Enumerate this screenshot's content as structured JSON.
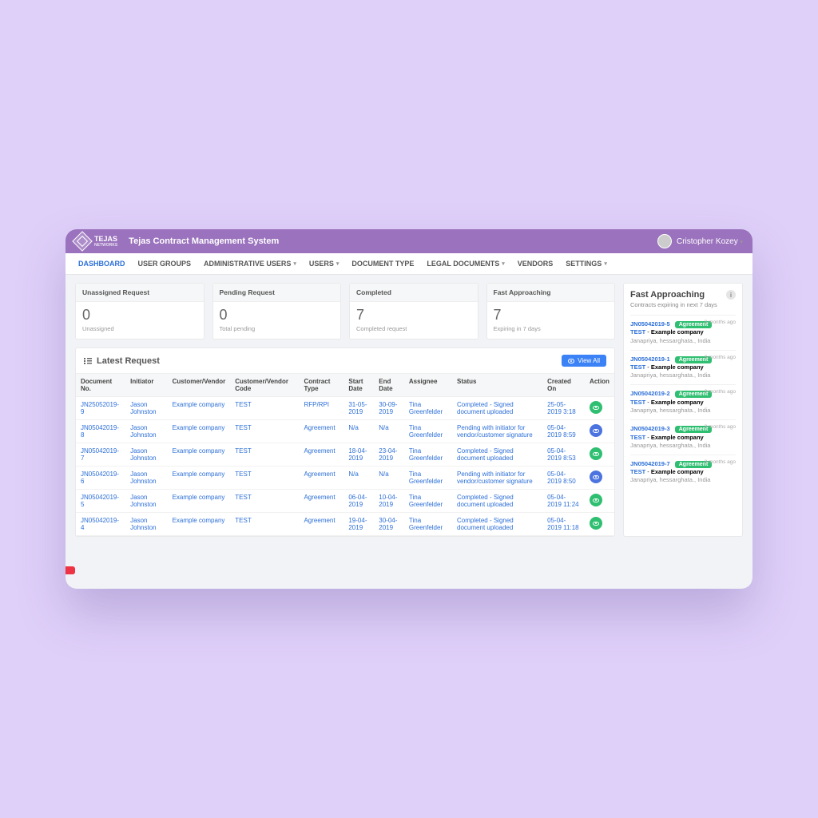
{
  "brand": "TEJAS",
  "brandSub": "NETWORKS",
  "appTitle": "Tejas Contract Management System",
  "user": "Cristopher Kozey",
  "nav": [
    "DASHBOARD",
    "USER GROUPS",
    "ADMINISTRATIVE USERS",
    "USERS",
    "DOCUMENT TYPE",
    "LEGAL DOCUMENTS",
    "VENDORS",
    "SETTINGS"
  ],
  "navHasChevron": [
    false,
    false,
    true,
    true,
    false,
    true,
    false,
    true
  ],
  "navActive": 0,
  "stats": [
    {
      "title": "Unassigned Request",
      "value": "0",
      "sub": "Unassigned"
    },
    {
      "title": "Pending Request",
      "value": "0",
      "sub": "Total pending"
    },
    {
      "title": "Completed",
      "value": "7",
      "sub": "Completed request"
    },
    {
      "title": "Fast Approaching",
      "value": "7",
      "sub": "Expiring in 7 days"
    }
  ],
  "latestTitle": "Latest Request",
  "viewAll": "View All",
  "columns": [
    "Document No.",
    "Initiator",
    "Customer/Vendor",
    "Customer/Vendor Code",
    "Contract Type",
    "Start Date",
    "End Date",
    "Assignee",
    "Status",
    "Created On",
    "Action"
  ],
  "rows": [
    {
      "doc": "JN25052019-9",
      "init": "Jason Johnston",
      "cust": "Example company",
      "code": "TEST",
      "ctype": "RFP/RPI",
      "start": "31-05-2019",
      "end": "30-09-2019",
      "assign": "Tina Greenfelder",
      "status": "Completed - Signed document uploaded",
      "created": "25-05-2019 3:18",
      "color": "green"
    },
    {
      "doc": "JN05042019-8",
      "init": "Jason Johnston",
      "cust": "Example company",
      "code": "TEST",
      "ctype": "Agreement",
      "start": "N/a",
      "end": "N/a",
      "assign": "Tina Greenfelder",
      "status": "Pending with initiator for vendor/customer signature",
      "created": "05-04-2019 8:59",
      "color": "blue"
    },
    {
      "doc": "JN05042019-7",
      "init": "Jason Johnston",
      "cust": "Example company",
      "code": "TEST",
      "ctype": "Agreement",
      "start": "18-04-2019",
      "end": "23-04-2019",
      "assign": "Tina Greenfelder",
      "status": "Completed - Signed document uploaded",
      "created": "05-04-2019 8:53",
      "color": "green"
    },
    {
      "doc": "JN05042019-6",
      "init": "Jason Johnston",
      "cust": "Example company",
      "code": "TEST",
      "ctype": "Agreement",
      "start": "N/a",
      "end": "N/a",
      "assign": "Tina Greenfelder",
      "status": "Pending with initiator for vendor/customer signature",
      "created": "05-04-2019 8:50",
      "color": "blue"
    },
    {
      "doc": "JN05042019-5",
      "init": "Jason Johnston",
      "cust": "Example company",
      "code": "TEST",
      "ctype": "Agreement",
      "start": "06-04-2019",
      "end": "10-04-2019",
      "assign": "Tina Greenfelder",
      "status": "Completed - Signed document uploaded",
      "created": "05-04-2019 11:24",
      "color": "green"
    },
    {
      "doc": "JN05042019-4",
      "init": "Jason Johnston",
      "cust": "Example company",
      "code": "TEST",
      "ctype": "Agreement",
      "start": "19-04-2019",
      "end": "30-04-2019",
      "assign": "Tina Greenfelder",
      "status": "Completed - Signed document uploaded",
      "created": "05-04-2019 11:18",
      "color": "green"
    }
  ],
  "fastApproaching": {
    "title": "Fast Approaching",
    "subtitle": "Contracts expiring in next 7 days",
    "badge": "Agreement",
    "time": "8 months ago",
    "companyLabel": "TEST",
    "companyName": "Example company",
    "location": "Janapriya, hessarghata., India",
    "items": [
      "JN05042019-5",
      "JN05042019-1",
      "JN05042019-2",
      "JN05042019-3",
      "JN05042019-7"
    ]
  }
}
